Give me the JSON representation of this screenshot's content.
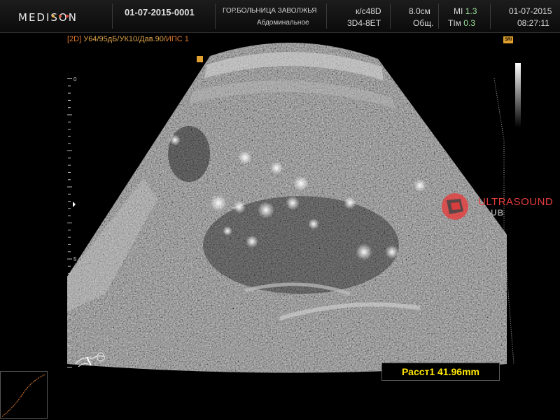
{
  "header": {
    "logo": "MEDISON",
    "dot_colors": [
      "#e8b040",
      "#e06040",
      "#e0403c"
    ],
    "patient_id": "01-07-2015-0001",
    "hospital": "ГОР.БОЛЬНИЦА ЗАВОЛЖЬЯ",
    "exam_type": "Абдоминальное",
    "preset": "к/с48D",
    "probe": "3D4-8ET",
    "depth": "8.0см",
    "mode_label": "Общ.",
    "mi_label": "MI",
    "mi_value": "1.3",
    "tim_label": "TIм",
    "tim_value": "0.3",
    "date": "01-07-2015",
    "time": "08:27:11"
  },
  "params": {
    "mode": "[2D]",
    "settings": "У64/95дБ/УК10/Дав.90/",
    "ips": "ИПС 1"
  },
  "badges": {
    "sri": "SRI"
  },
  "ruler": {
    "labels": [
      "0",
      "5"
    ]
  },
  "measurement": {
    "text": "Расст1 41.96mm"
  },
  "watermark": {
    "title": "ULTRASOUND",
    "subtitle": "CLUB"
  },
  "colors": {
    "accent_orange": "#e0a030",
    "measure_yellow": "#ffe600",
    "watermark_red": "#e63c3c",
    "tissue_gray": "#8a8a8a"
  }
}
